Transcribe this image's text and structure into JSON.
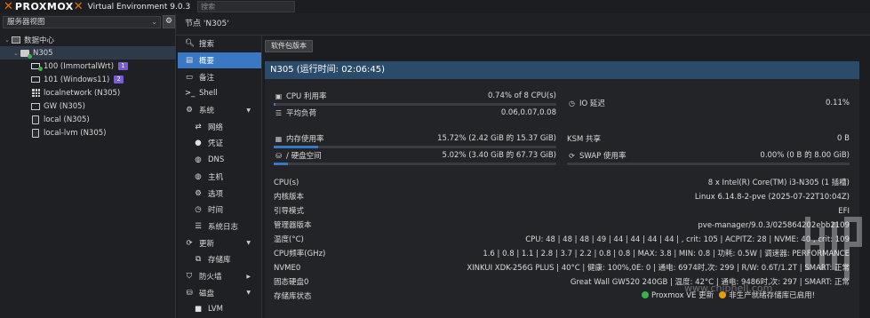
{
  "topbar": {
    "logo": "PROXMOX",
    "version": "Virtual Environment 9.0.3",
    "search_placeholder": "搜索"
  },
  "tree_panel": {
    "view_label": "服务器视图",
    "items": [
      {
        "label": "数据中心",
        "type": "datacenter"
      },
      {
        "label": "N305",
        "type": "node"
      },
      {
        "label": "100 (ImmortalWrt)",
        "badge": "1",
        "type": "vm-running"
      },
      {
        "label": "101 (Windows11)",
        "badge": "2",
        "type": "vm"
      },
      {
        "label": "localnetwork (N305)",
        "type": "network"
      },
      {
        "label": "GW (N305)",
        "type": "storage"
      },
      {
        "label": "local (N305)",
        "type": "storage"
      },
      {
        "label": "local-lvm (N305)",
        "type": "storage"
      }
    ]
  },
  "breadcrumb": "节点 'N305'",
  "menu": [
    {
      "label": "搜索",
      "icon": "search-icon"
    },
    {
      "label": "概要",
      "icon": "summary-icon",
      "active": true
    },
    {
      "label": "备注",
      "icon": "notes-icon"
    },
    {
      "label": "Shell",
      "icon": "terminal-icon"
    },
    {
      "label": "系统",
      "icon": "gears-icon",
      "expandable": true
    },
    {
      "label": "网络",
      "icon": "network-icon",
      "sub": true
    },
    {
      "label": "凭证",
      "icon": "certificate-icon",
      "sub": true
    },
    {
      "label": "DNS",
      "icon": "globe-icon",
      "sub": true
    },
    {
      "label": "主机",
      "icon": "globe-icon",
      "sub": true
    },
    {
      "label": "选项",
      "icon": "gear-icon",
      "sub": true
    },
    {
      "label": "时间",
      "icon": "clock-icon",
      "sub": true
    },
    {
      "label": "系统日志",
      "icon": "list-icon",
      "sub": true
    },
    {
      "label": "更新",
      "icon": "refresh-icon",
      "expandable": true
    },
    {
      "label": "存储库",
      "icon": "repository-icon",
      "sub": true
    },
    {
      "label": "防火墙",
      "icon": "shield-icon",
      "expandable": true
    },
    {
      "label": "磁盘",
      "icon": "disk-icon",
      "expandable": true
    },
    {
      "label": "LVM",
      "icon": "square-icon",
      "sub": true
    }
  ],
  "toolbar": {
    "package_versions": "软件包版本"
  },
  "summary": {
    "title": "N305 (运行时间: 02:06:45)",
    "cpu_label": "CPU 利用率",
    "cpu_value": "0.74% of 8 CPU(s)",
    "cpu_fraction": 0.0074,
    "io_label": "IO 延迟",
    "io_value": "0.11%",
    "io_fraction": 0.0011,
    "load_label": "平均负荷",
    "load_value": "0.06,0.07,0.08",
    "mem_label": "内存使用率",
    "mem_value": "15.72% (2.42 GiB 的 15.37 GiB)",
    "mem_fraction": 0.1572,
    "ksm_label": "KSM 共享",
    "ksm_value": "0 B",
    "disk_label": "/ 硬盘空间",
    "disk_value": "5.02% (3.40 GiB 的 67.73 GiB)",
    "disk_fraction": 0.0502,
    "swap_label": "SWAP 使用率",
    "swap_value": "0.00% (0 B 的 8.00 GiB)",
    "swap_fraction": 0.0
  },
  "info": [
    {
      "key": "CPU(s)",
      "value": "8 x Intel(R) Core(TM) i3-N305 (1 插槽)"
    },
    {
      "key": "内核版本",
      "value": "Linux 6.14.8-2-pve (2025-07-22T10:04Z)"
    },
    {
      "key": "引导模式",
      "value": "EFI"
    },
    {
      "key": "管理器版本",
      "value": "pve-manager/9.0.3/025864202ebb2109"
    },
    {
      "key": "温度(°C)",
      "value": "CPU: 48 | 48 | 48 | 49 | 44 | 44 | 44 | 44 | , crit: 105 | ACPITZ: 28 | NVME: 40 , crit: 109"
    },
    {
      "key": "CPU频率(GHz)",
      "value": "1.6 | 0.8 | 1.1 | 2.8 | 3.7 | 2.2 | 0.8 | 0.8 | MAX: 3.8 | MIN: 0.8 | 功耗: 0.5W | 调速器: PERFORMANCE"
    },
    {
      "key": "NVME0",
      "value": "XINKUI XDK-256G PLUS | 40°C | 健康: 100%,0E: 0 | 通电: 6974时,次: 299 | R/W: 0.6T/1.2T | SMART: 正常"
    },
    {
      "key": "固态硬盘0",
      "value": "Great Wall GW520 240GB | 温度: 42°C | 通电: 9486时,次: 297 | SMART: 正常"
    },
    {
      "key": "存储库状态",
      "value": ""
    }
  ],
  "repo_status": {
    "ok": "Proxmox VE 更新",
    "warn": "非生产就绪存储库已启用!"
  },
  "watermark": "www.chiphell.com",
  "colors": {
    "accent": "#3a78c3",
    "brand_orange": "#e57000",
    "title_bar": "#2b4b6a",
    "badge": "#7b5cd6",
    "ok": "#3cb34a",
    "warn": "#e5a000"
  }
}
